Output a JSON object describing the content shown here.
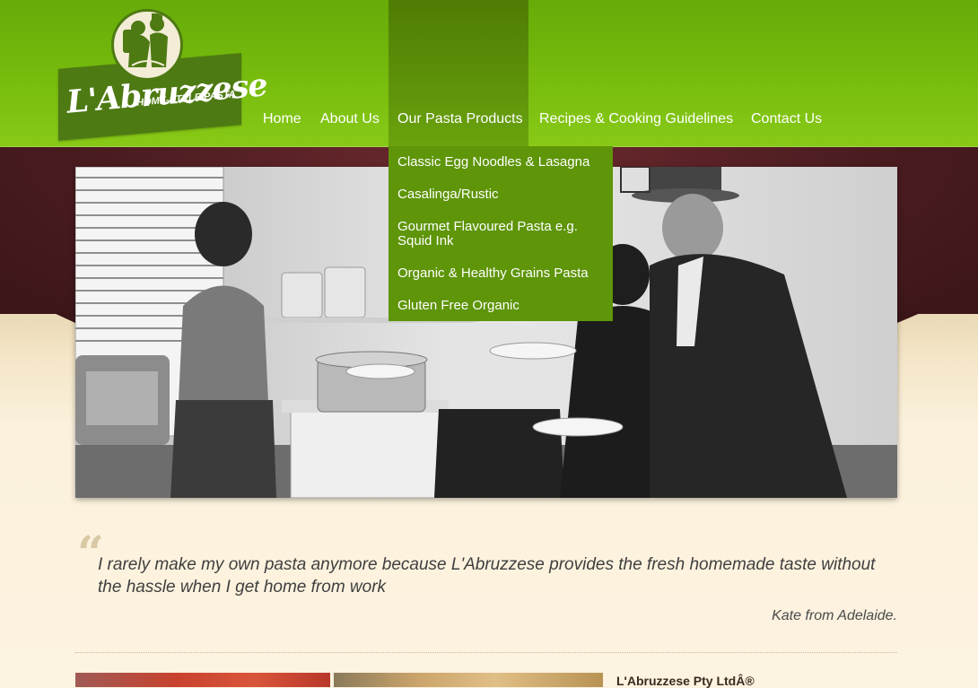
{
  "brand": {
    "name": "L'Abruzzese",
    "tagline": "HOME-STYLE PASTA"
  },
  "nav": {
    "items": [
      {
        "label": "Home"
      },
      {
        "label": "About Us"
      },
      {
        "label": "Our Pasta Products",
        "active": true
      },
      {
        "label": "Recipes & Cooking Guidelines"
      },
      {
        "label": "Contact Us"
      }
    ]
  },
  "dropdown": {
    "items": [
      {
        "label": "Classic Egg Noodles & Lasagna"
      },
      {
        "label": "Casalinga/Rustic"
      },
      {
        "label": "Gourmet Flavoured Pasta e.g. Squid Ink"
      },
      {
        "label": "Organic & Healthy Grains Pasta"
      },
      {
        "label": "Gluten Free Organic"
      }
    ]
  },
  "testimonial": {
    "mark": "“",
    "text": "I rarely make my own pasta anymore because L'Abruzzese provides the fresh homemade taste without the hassle when I get home from work",
    "author": "Kate from Adelaide."
  },
  "footer": {
    "company": "L'Abruzzese Pty LtdÂ®"
  },
  "colors": {
    "header_green": "#7bbf0f",
    "nav_active": "#5f930a",
    "maroon": "#4a1c20",
    "cream": "#fbf1dc"
  }
}
